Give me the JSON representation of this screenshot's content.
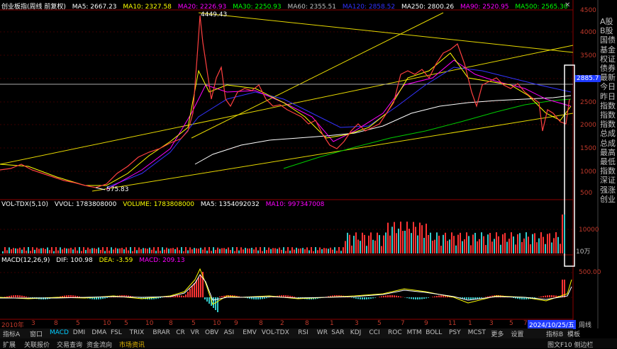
{
  "window": {
    "title": "创业板指(周线 前复权)"
  },
  "price_legend": {
    "ma5": "MA5: 2667.23",
    "ma10": "MA10: 2327.58",
    "ma20": "MA20: 2226.93",
    "ma30": "MA30: 2250.93",
    "ma60": "MA60: 2355.51",
    "ma120": "MA120: 2858.52",
    "ma250": "MA250: 2800.26",
    "ma90": "MA90: 2520.95",
    "ma500": "MA500: 2565.30"
  },
  "price_axis": [
    "4500",
    "4000",
    "3500",
    "3000",
    "2500",
    "2000",
    "1500",
    "1000",
    "500"
  ],
  "price_marks": {
    "high": "4449.43",
    "low": "575.83",
    "current": "2885.7"
  },
  "vol_legend": {
    "name": "VOL-TDX(5,10)",
    "vvol": "VVOL: 1783808000",
    "volume": "VOLUME: 1783808000",
    "ma5": "MA5: 1354092032",
    "ma10": "MA10: 997347008"
  },
  "vol_axis": [
    "10000",
    "10万"
  ],
  "macd_legend": {
    "name": "MACD(12,26,9)",
    "dif": "DIF: 100.98",
    "dea": "DEA: -3.59",
    "macd": "MACD: 209.13"
  },
  "macd_axis": [
    "500.00",
    "0.00"
  ],
  "date_labels": [
    "2010年",
    "3",
    "8",
    "5",
    "10",
    "5",
    "10",
    "8",
    "5",
    "10",
    "9",
    "8",
    "2",
    "8",
    "1",
    "3",
    "5",
    "7",
    "9",
    "11",
    "1",
    "3",
    "5",
    "7",
    "9",
    "11"
  ],
  "date_marker": "2024/10/25/五",
  "tabs": [
    "指标A",
    "窗口",
    "MACD",
    "DMI",
    "DMA",
    "FSL",
    "TRIX",
    "BRAR",
    "CR",
    "VR",
    "OBV",
    "ASI",
    "EMV",
    "VOL-TDX",
    "RSI",
    "WR",
    "SAR",
    "KDJ",
    "CCI",
    "ROC",
    "MTM",
    "BOLL",
    "PSY",
    "MCST",
    "更多",
    "设置"
  ],
  "tabs_right": [
    "指标B",
    "模板",
    "周线"
  ],
  "bottom_bar": [
    "扩展",
    "关联报价",
    "交易查询",
    "资金流向",
    "市场资讯"
  ],
  "bottom_right": "图文F10 侧边栏",
  "side_items": [
    "A股",
    "B股",
    "国债",
    "基金",
    "权证",
    "债券",
    "最新",
    "今日",
    "昨日",
    "指数",
    "指数",
    "指数",
    "总成",
    "总成",
    "最高",
    "最低",
    "指数",
    "深证",
    "强涨",
    "创业"
  ],
  "colors": {
    "up": "#ff3333",
    "down": "#33cccc",
    "ma5": "#ffffff",
    "ma10": "#ffff00",
    "ma20": "#ff00ff",
    "ma30": "#00ff00"
  }
}
